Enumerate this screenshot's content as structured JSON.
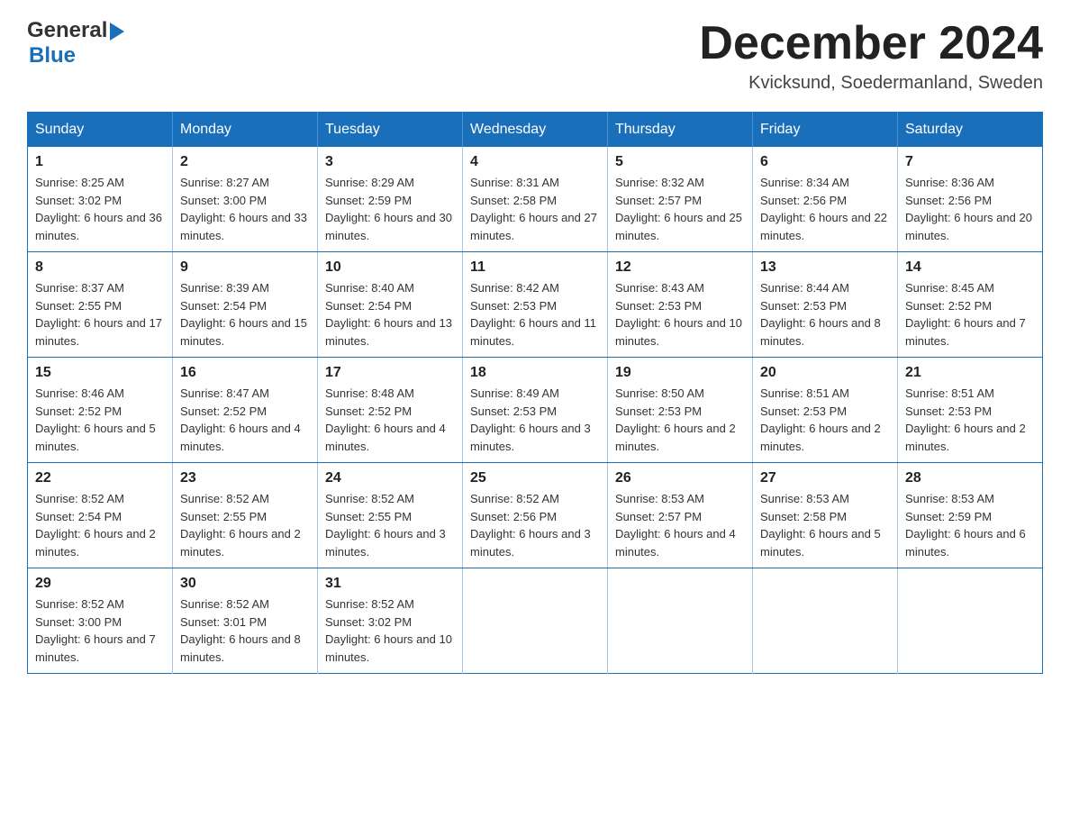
{
  "header": {
    "logo_general": "General",
    "logo_blue": "Blue",
    "month_title": "December 2024",
    "location": "Kvicksund, Soedermanland, Sweden"
  },
  "calendar": {
    "days_of_week": [
      "Sunday",
      "Monday",
      "Tuesday",
      "Wednesday",
      "Thursday",
      "Friday",
      "Saturday"
    ],
    "weeks": [
      [
        {
          "day": "1",
          "sunrise": "Sunrise: 8:25 AM",
          "sunset": "Sunset: 3:02 PM",
          "daylight": "Daylight: 6 hours and 36 minutes."
        },
        {
          "day": "2",
          "sunrise": "Sunrise: 8:27 AM",
          "sunset": "Sunset: 3:00 PM",
          "daylight": "Daylight: 6 hours and 33 minutes."
        },
        {
          "day": "3",
          "sunrise": "Sunrise: 8:29 AM",
          "sunset": "Sunset: 2:59 PM",
          "daylight": "Daylight: 6 hours and 30 minutes."
        },
        {
          "day": "4",
          "sunrise": "Sunrise: 8:31 AM",
          "sunset": "Sunset: 2:58 PM",
          "daylight": "Daylight: 6 hours and 27 minutes."
        },
        {
          "day": "5",
          "sunrise": "Sunrise: 8:32 AM",
          "sunset": "Sunset: 2:57 PM",
          "daylight": "Daylight: 6 hours and 25 minutes."
        },
        {
          "day": "6",
          "sunrise": "Sunrise: 8:34 AM",
          "sunset": "Sunset: 2:56 PM",
          "daylight": "Daylight: 6 hours and 22 minutes."
        },
        {
          "day": "7",
          "sunrise": "Sunrise: 8:36 AM",
          "sunset": "Sunset: 2:56 PM",
          "daylight": "Daylight: 6 hours and 20 minutes."
        }
      ],
      [
        {
          "day": "8",
          "sunrise": "Sunrise: 8:37 AM",
          "sunset": "Sunset: 2:55 PM",
          "daylight": "Daylight: 6 hours and 17 minutes."
        },
        {
          "day": "9",
          "sunrise": "Sunrise: 8:39 AM",
          "sunset": "Sunset: 2:54 PM",
          "daylight": "Daylight: 6 hours and 15 minutes."
        },
        {
          "day": "10",
          "sunrise": "Sunrise: 8:40 AM",
          "sunset": "Sunset: 2:54 PM",
          "daylight": "Daylight: 6 hours and 13 minutes."
        },
        {
          "day": "11",
          "sunrise": "Sunrise: 8:42 AM",
          "sunset": "Sunset: 2:53 PM",
          "daylight": "Daylight: 6 hours and 11 minutes."
        },
        {
          "day": "12",
          "sunrise": "Sunrise: 8:43 AM",
          "sunset": "Sunset: 2:53 PM",
          "daylight": "Daylight: 6 hours and 10 minutes."
        },
        {
          "day": "13",
          "sunrise": "Sunrise: 8:44 AM",
          "sunset": "Sunset: 2:53 PM",
          "daylight": "Daylight: 6 hours and 8 minutes."
        },
        {
          "day": "14",
          "sunrise": "Sunrise: 8:45 AM",
          "sunset": "Sunset: 2:52 PM",
          "daylight": "Daylight: 6 hours and 7 minutes."
        }
      ],
      [
        {
          "day": "15",
          "sunrise": "Sunrise: 8:46 AM",
          "sunset": "Sunset: 2:52 PM",
          "daylight": "Daylight: 6 hours and 5 minutes."
        },
        {
          "day": "16",
          "sunrise": "Sunrise: 8:47 AM",
          "sunset": "Sunset: 2:52 PM",
          "daylight": "Daylight: 6 hours and 4 minutes."
        },
        {
          "day": "17",
          "sunrise": "Sunrise: 8:48 AM",
          "sunset": "Sunset: 2:52 PM",
          "daylight": "Daylight: 6 hours and 4 minutes."
        },
        {
          "day": "18",
          "sunrise": "Sunrise: 8:49 AM",
          "sunset": "Sunset: 2:53 PM",
          "daylight": "Daylight: 6 hours and 3 minutes."
        },
        {
          "day": "19",
          "sunrise": "Sunrise: 8:50 AM",
          "sunset": "Sunset: 2:53 PM",
          "daylight": "Daylight: 6 hours and 2 minutes."
        },
        {
          "day": "20",
          "sunrise": "Sunrise: 8:51 AM",
          "sunset": "Sunset: 2:53 PM",
          "daylight": "Daylight: 6 hours and 2 minutes."
        },
        {
          "day": "21",
          "sunrise": "Sunrise: 8:51 AM",
          "sunset": "Sunset: 2:53 PM",
          "daylight": "Daylight: 6 hours and 2 minutes."
        }
      ],
      [
        {
          "day": "22",
          "sunrise": "Sunrise: 8:52 AM",
          "sunset": "Sunset: 2:54 PM",
          "daylight": "Daylight: 6 hours and 2 minutes."
        },
        {
          "day": "23",
          "sunrise": "Sunrise: 8:52 AM",
          "sunset": "Sunset: 2:55 PM",
          "daylight": "Daylight: 6 hours and 2 minutes."
        },
        {
          "day": "24",
          "sunrise": "Sunrise: 8:52 AM",
          "sunset": "Sunset: 2:55 PM",
          "daylight": "Daylight: 6 hours and 3 minutes."
        },
        {
          "day": "25",
          "sunrise": "Sunrise: 8:52 AM",
          "sunset": "Sunset: 2:56 PM",
          "daylight": "Daylight: 6 hours and 3 minutes."
        },
        {
          "day": "26",
          "sunrise": "Sunrise: 8:53 AM",
          "sunset": "Sunset: 2:57 PM",
          "daylight": "Daylight: 6 hours and 4 minutes."
        },
        {
          "day": "27",
          "sunrise": "Sunrise: 8:53 AM",
          "sunset": "Sunset: 2:58 PM",
          "daylight": "Daylight: 6 hours and 5 minutes."
        },
        {
          "day": "28",
          "sunrise": "Sunrise: 8:53 AM",
          "sunset": "Sunset: 2:59 PM",
          "daylight": "Daylight: 6 hours and 6 minutes."
        }
      ],
      [
        {
          "day": "29",
          "sunrise": "Sunrise: 8:52 AM",
          "sunset": "Sunset: 3:00 PM",
          "daylight": "Daylight: 6 hours and 7 minutes."
        },
        {
          "day": "30",
          "sunrise": "Sunrise: 8:52 AM",
          "sunset": "Sunset: 3:01 PM",
          "daylight": "Daylight: 6 hours and 8 minutes."
        },
        {
          "day": "31",
          "sunrise": "Sunrise: 8:52 AM",
          "sunset": "Sunset: 3:02 PM",
          "daylight": "Daylight: 6 hours and 10 minutes."
        },
        null,
        null,
        null,
        null
      ]
    ]
  }
}
